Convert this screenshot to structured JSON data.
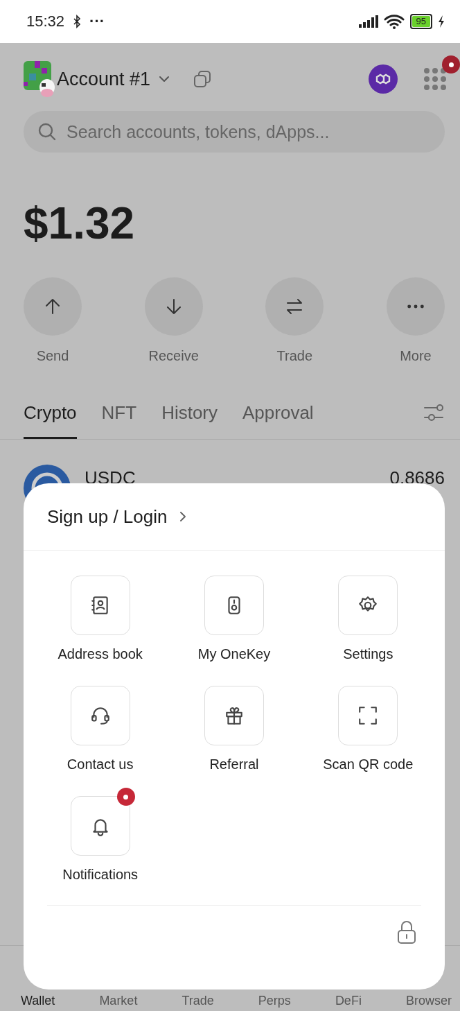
{
  "status_bar": {
    "time": "15:32",
    "more": "···",
    "battery": "95"
  },
  "header": {
    "account": "Account #1",
    "apps_badge": true
  },
  "search": {
    "placeholder": "Search accounts, tokens, dApps..."
  },
  "balance": "$1.32",
  "actions": [
    {
      "kind": "send",
      "label": "Send"
    },
    {
      "kind": "receive",
      "label": "Receive"
    },
    {
      "kind": "trade",
      "label": "Trade"
    },
    {
      "kind": "more",
      "label": "More"
    }
  ],
  "tabs": [
    {
      "label": "Crypto",
      "selected": true
    },
    {
      "label": "NFT",
      "selected": false
    },
    {
      "label": "History",
      "selected": false
    },
    {
      "label": "Approval",
      "selected": false
    }
  ],
  "tokens": [
    {
      "name": "USDC",
      "amount": "0.8686"
    }
  ],
  "menu": {
    "login": "Sign up / Login",
    "items": [
      {
        "kind": "address",
        "label": "Address book",
        "badge": false
      },
      {
        "kind": "device",
        "label": "My OneKey",
        "badge": false
      },
      {
        "kind": "settings",
        "label": "Settings",
        "badge": false
      },
      {
        "kind": "support",
        "label": "Contact us",
        "badge": false
      },
      {
        "kind": "gift",
        "label": "Referral",
        "badge": false
      },
      {
        "kind": "scan",
        "label": "Scan QR code",
        "badge": false
      },
      {
        "kind": "bell",
        "label": "Notifications",
        "badge": true
      }
    ]
  },
  "nav": [
    {
      "label": "Wallet",
      "selected": true
    },
    {
      "label": "Market",
      "selected": false
    },
    {
      "label": "Trade",
      "selected": false
    },
    {
      "label": "Perps",
      "selected": false
    },
    {
      "label": "DeFi",
      "selected": false
    },
    {
      "label": "Browser",
      "selected": false
    }
  ]
}
